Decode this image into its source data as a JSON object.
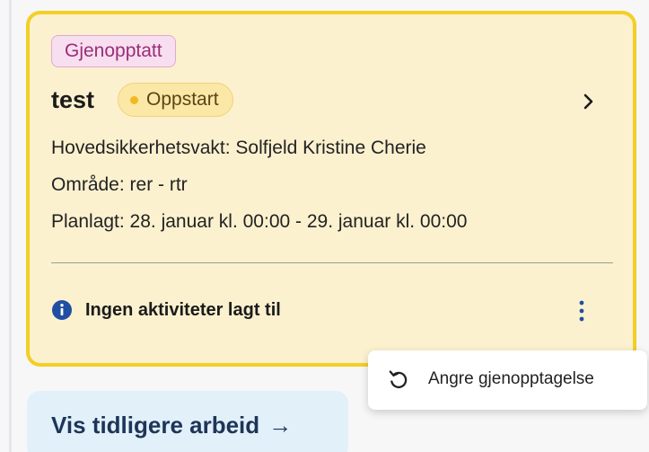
{
  "card": {
    "status_tag": "Gjenopptatt",
    "title": "test",
    "phase_tag": "Oppstart",
    "safety_guard": "Hovedsikkerhetsvakt: Solfjeld Kristine Cherie",
    "area": "Område: rer - rtr",
    "planned": "Planlagt: 28. januar kl. 00:00 - 29. januar kl. 00:00",
    "activities_notice": "Ingen aktiviteter lagt til"
  },
  "context_menu": {
    "undo_label": "Angre gjenopptagelse"
  },
  "earlier_work": {
    "label": "Vis tidligere arbeid",
    "arrow": "→"
  },
  "colors": {
    "card_bg": "#fcf1cf",
    "card_border": "#f3cf26",
    "status_tag_bg": "#f8dff0",
    "phase_tag_bg": "#fbe7a6",
    "info_icon": "#1f4fa3",
    "earlier_btn_bg": "#e2f0fa"
  },
  "icons": {
    "chevron": "chevron-right-icon",
    "info": "info-icon",
    "more": "kebab-menu-icon",
    "undo": "undo-icon"
  }
}
